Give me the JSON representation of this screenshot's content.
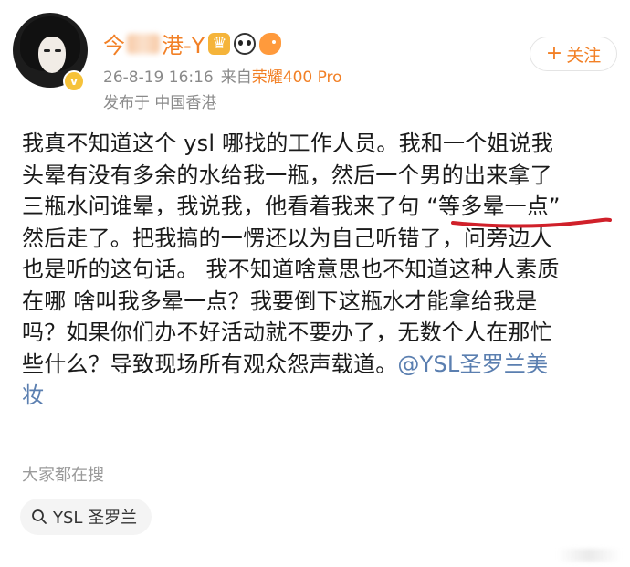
{
  "post": {
    "author": {
      "name_prefix": "今",
      "name_suffix": "港-Y",
      "avatar": "avatar-icon",
      "verified_mark": "v"
    },
    "meta": {
      "timestamp": "26-8-19 16:16",
      "source_prefix": "来自",
      "device": "荣耀400 Pro",
      "location": "发布于 中国香港"
    },
    "follow_button": {
      "plus": "+",
      "label": "关注"
    },
    "body_lines": [
      "我真不知道这个 ysl 哪找的工作人员。我和一个姐说我",
      "头晕有没有多余的水给我一瓶，然后一个男的出来拿了",
      "三瓶水问谁晕，我说我，他看着我来了句 “等多晕一点”",
      "然后走了。把我搞的一愣还以为自己听错了，问旁边人",
      "也是听的这句话。 我不知道啥意思也不知道这种人素质",
      "在哪 啥叫我多晕一点？我要倒下这瓶水才能拿给我是",
      "吗？如果你们办不好活动就不要办了，无数个人在那忙",
      "些什么？导致现场所有观众怨声载道。"
    ],
    "mention": "@YSL圣罗兰美",
    "last_line": "妆"
  },
  "search": {
    "label": "大家都在搜",
    "chip": "YSL 圣罗兰"
  },
  "colors": {
    "accent": "#f28026",
    "mention": "#5b7fb0",
    "underline": "#d0202a"
  }
}
